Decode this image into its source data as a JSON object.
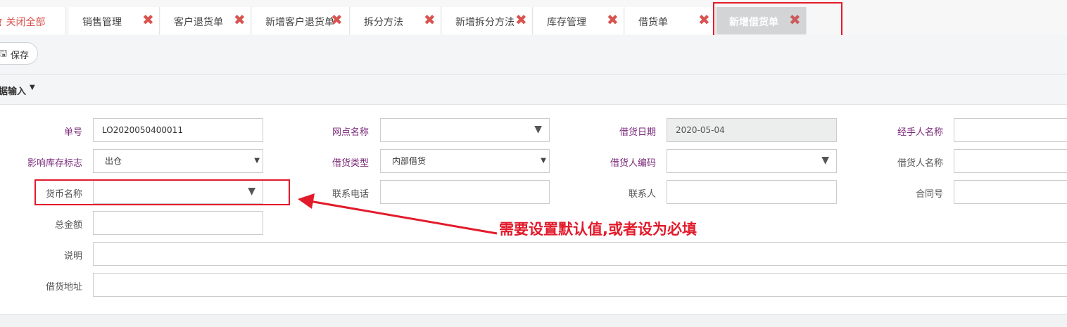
{
  "tabs": [
    {
      "label": "倉 关闭全部",
      "closable": false
    },
    {
      "label": "销售管理",
      "closable": true
    },
    {
      "label": "客户退货单",
      "closable": true
    },
    {
      "label": "新增客户退货单",
      "closable": true
    },
    {
      "label": "拆分方法",
      "closable": true
    },
    {
      "label": "新增拆分方法",
      "closable": true
    },
    {
      "label": "库存管理",
      "closable": true
    },
    {
      "label": "借货单",
      "closable": true
    },
    {
      "label": "新增借货单",
      "closable": true,
      "active": true
    }
  ],
  "close_glyph": "✖",
  "toolbar": {
    "save_label": "保存",
    "save_icon": "floppy-icon"
  },
  "section": {
    "title": "据输入"
  },
  "form": {
    "order_no": {
      "label": "单号",
      "value": "LO2020050400011"
    },
    "branch": {
      "label": "网点名称",
      "value": ""
    },
    "loan_date": {
      "label": "借货日期",
      "value": "2020-05-04"
    },
    "handler": {
      "label": "经手人名称",
      "value": ""
    },
    "stock_flag": {
      "label": "影响库存标志",
      "value": "出仓"
    },
    "loan_type": {
      "label": "借货类型",
      "value": "内部借货"
    },
    "borrower_code": {
      "label": "借货人编码",
      "value": ""
    },
    "borrower_name": {
      "label": "借货人名称",
      "value": ""
    },
    "currency": {
      "label": "货币名称",
      "value": ""
    },
    "phone": {
      "label": "联系电话",
      "value": ""
    },
    "contact": {
      "label": "联系人",
      "value": ""
    },
    "contract_no": {
      "label": "合同号",
      "value": ""
    },
    "total": {
      "label": "总金额",
      "value": ""
    },
    "remark": {
      "label": "说明",
      "value": ""
    },
    "address": {
      "label": "借货地址",
      "value": ""
    }
  },
  "annotation": {
    "text": "需要设置默认值,或者设为必填",
    "color": "#e21b2b"
  }
}
